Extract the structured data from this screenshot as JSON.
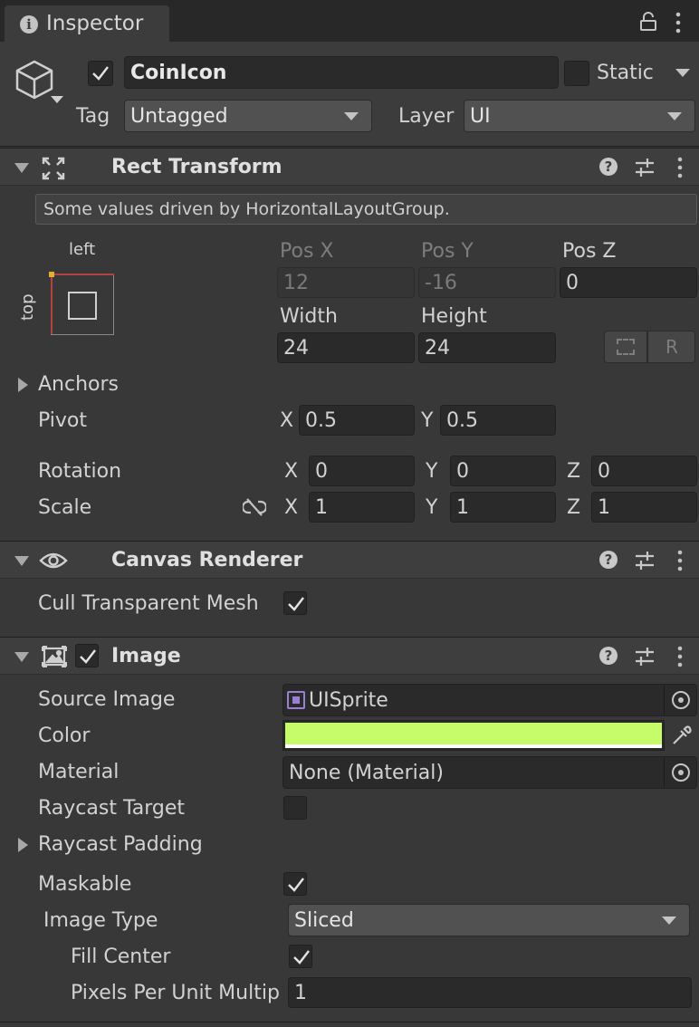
{
  "tab": {
    "title": "Inspector"
  },
  "gameobject": {
    "active": true,
    "name": "CoinIcon",
    "static_label": "Static",
    "static_checked": false,
    "tag_label": "Tag",
    "tag_value": "Untagged",
    "layer_label": "Layer",
    "layer_value": "UI"
  },
  "rect_transform": {
    "title": "Rect Transform",
    "notice": "Some values driven by HorizontalLayoutGroup.",
    "anchor_h": "left",
    "anchor_v": "top",
    "posx_label": "Pos X",
    "posy_label": "Pos Y",
    "posz_label": "Pos Z",
    "posx": "12",
    "posy": "-16",
    "posz": "0",
    "width_label": "Width",
    "height_label": "Height",
    "width": "24",
    "height": "24",
    "raw_button": "R",
    "anchors_label": "Anchors",
    "pivot_label": "Pivot",
    "pivot_x_label": "X",
    "pivot_x": "0.5",
    "pivot_y_label": "Y",
    "pivot_y": "0.5",
    "rotation_label": "Rotation",
    "rot_x": "0",
    "rot_y": "0",
    "rot_z": "0",
    "scale_label": "Scale",
    "scale_x": "1",
    "scale_y": "1",
    "scale_z": "1",
    "x_label": "X",
    "y_label": "Y",
    "z_label": "Z"
  },
  "canvas_renderer": {
    "title": "Canvas Renderer",
    "cull_label": "Cull Transparent Mesh",
    "cull_checked": true
  },
  "image": {
    "title": "Image",
    "enabled": true,
    "source_label": "Source Image",
    "source_value": "UISprite",
    "color_label": "Color",
    "color_value": "#c6fb69",
    "material_label": "Material",
    "material_value": "None (Material)",
    "raycast_target_label": "Raycast Target",
    "raycast_target_checked": false,
    "raycast_padding_label": "Raycast Padding",
    "maskable_label": "Maskable",
    "maskable_checked": true,
    "image_type_label": "Image Type",
    "image_type_value": "Sliced",
    "fill_center_label": "Fill Center",
    "fill_center_checked": true,
    "ppu_label": "Pixels Per Unit Multip",
    "ppu_value": "1"
  }
}
